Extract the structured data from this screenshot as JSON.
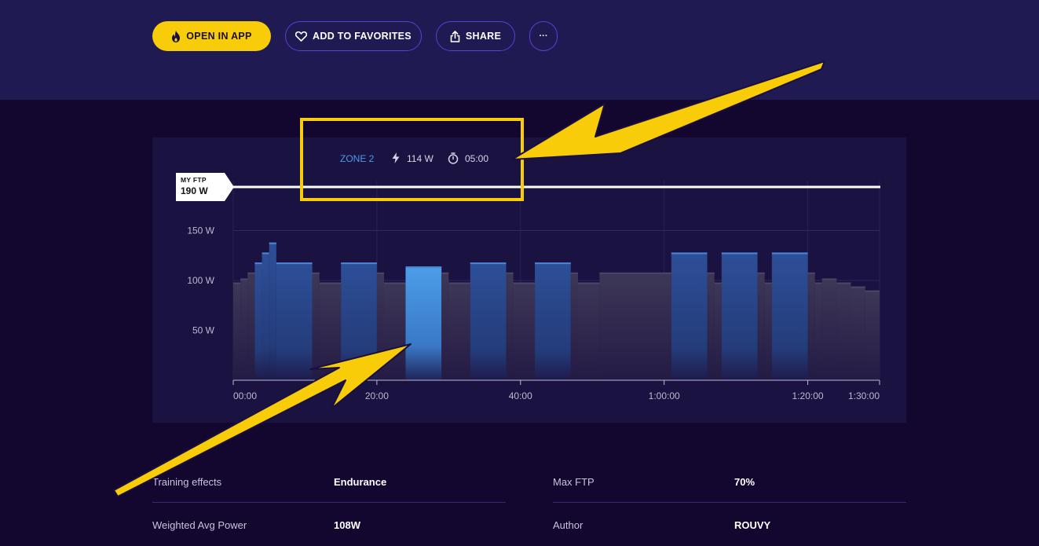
{
  "actions": {
    "open_in_app": "OPEN IN APP",
    "add_to_favorites": "ADD TO FAVORITES",
    "share": "SHARE",
    "more": "···"
  },
  "tooltip": {
    "zone": "ZONE 2",
    "power": "114 W",
    "duration": "05:00"
  },
  "ftp": {
    "label": "MY FTP",
    "value": "190 W"
  },
  "chart_data": {
    "type": "bar",
    "ftp_watts": 190,
    "ylim": [
      0,
      160
    ],
    "y_ticks": [
      {
        "value": 50,
        "label": "50 W"
      },
      {
        "value": 100,
        "label": "100 W"
      },
      {
        "value": 150,
        "label": "150 W"
      }
    ],
    "xlim": [
      0,
      90
    ],
    "x_ticks": [
      {
        "value": 0,
        "label": "00:00"
      },
      {
        "value": 20,
        "label": "20:00"
      },
      {
        "value": 40,
        "label": "40:00"
      },
      {
        "value": 60,
        "label": "1:00:00"
      },
      {
        "value": 80,
        "label": "1:20:00"
      },
      {
        "value": 90,
        "label": "1:30:00"
      }
    ],
    "segments": [
      {
        "start": 0,
        "end": 1,
        "watts": 98,
        "zone": 1
      },
      {
        "start": 1,
        "end": 2,
        "watts": 102,
        "zone": 1
      },
      {
        "start": 2,
        "end": 3,
        "watts": 108,
        "zone": 1
      },
      {
        "start": 3,
        "end": 4,
        "watts": 118,
        "zone": 2
      },
      {
        "start": 4,
        "end": 5,
        "watts": 128,
        "zone": 2
      },
      {
        "start": 5,
        "end": 6,
        "watts": 138,
        "zone": 2
      },
      {
        "start": 6,
        "end": 11,
        "watts": 118,
        "zone": 2
      },
      {
        "start": 11,
        "end": 12,
        "watts": 108,
        "zone": 1
      },
      {
        "start": 12,
        "end": 15,
        "watts": 98,
        "zone": 1
      },
      {
        "start": 15,
        "end": 20,
        "watts": 118,
        "zone": 2
      },
      {
        "start": 20,
        "end": 21,
        "watts": 108,
        "zone": 1
      },
      {
        "start": 21,
        "end": 24,
        "watts": 98,
        "zone": 1
      },
      {
        "start": 24,
        "end": 29,
        "watts": 114,
        "zone": 2,
        "selected": true
      },
      {
        "start": 29,
        "end": 30,
        "watts": 108,
        "zone": 1
      },
      {
        "start": 30,
        "end": 33,
        "watts": 98,
        "zone": 1
      },
      {
        "start": 33,
        "end": 38,
        "watts": 118,
        "zone": 2
      },
      {
        "start": 38,
        "end": 39,
        "watts": 108,
        "zone": 1
      },
      {
        "start": 39,
        "end": 42,
        "watts": 98,
        "zone": 1
      },
      {
        "start": 42,
        "end": 47,
        "watts": 118,
        "zone": 2
      },
      {
        "start": 47,
        "end": 48,
        "watts": 108,
        "zone": 1
      },
      {
        "start": 48,
        "end": 51,
        "watts": 98,
        "zone": 1
      },
      {
        "start": 51,
        "end": 61,
        "watts": 108,
        "zone": 1
      },
      {
        "start": 61,
        "end": 66,
        "watts": 128,
        "zone": 2
      },
      {
        "start": 66,
        "end": 67,
        "watts": 108,
        "zone": 1
      },
      {
        "start": 67,
        "end": 68,
        "watts": 98,
        "zone": 1
      },
      {
        "start": 68,
        "end": 73,
        "watts": 128,
        "zone": 2
      },
      {
        "start": 73,
        "end": 74,
        "watts": 108,
        "zone": 1
      },
      {
        "start": 74,
        "end": 75,
        "watts": 98,
        "zone": 1
      },
      {
        "start": 75,
        "end": 80,
        "watts": 128,
        "zone": 2
      },
      {
        "start": 80,
        "end": 81,
        "watts": 108,
        "zone": 1
      },
      {
        "start": 81,
        "end": 82,
        "watts": 98,
        "zone": 1
      },
      {
        "start": 82,
        "end": 84,
        "watts": 102,
        "zone": 1
      },
      {
        "start": 84,
        "end": 86,
        "watts": 98,
        "zone": 1
      },
      {
        "start": 86,
        "end": 88,
        "watts": 94,
        "zone": 1
      },
      {
        "start": 88,
        "end": 90,
        "watts": 90,
        "zone": 1
      }
    ]
  },
  "stats": [
    {
      "label": "Training effects",
      "value": "Endurance"
    },
    {
      "label": "Max FTP",
      "value": "70%"
    },
    {
      "label": "Weighted Avg Power",
      "value": "108W"
    },
    {
      "label": "Author",
      "value": "ROUVY"
    }
  ],
  "colors": {
    "accent": "#f8cc08",
    "zone1": "#3b3556",
    "zone2": "#2c4f95",
    "selected": "#4a9be8"
  }
}
